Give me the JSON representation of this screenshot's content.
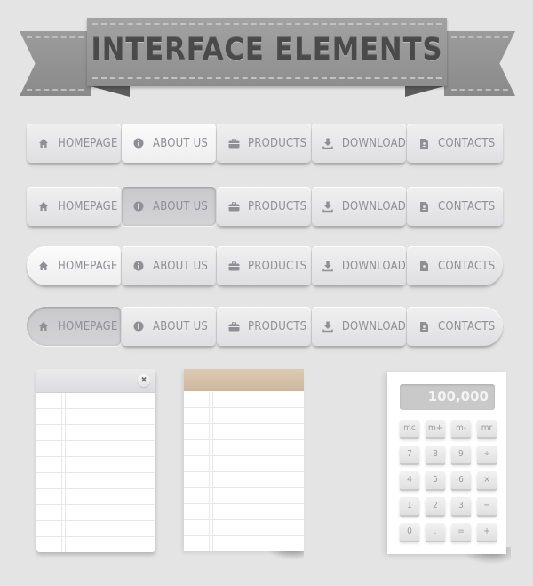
{
  "banner": {
    "title": "INTERFACE ELEMENTS"
  },
  "colors": {
    "background": "#e4e4e4",
    "ribbon": "#969696",
    "button_text": "#8f8f94",
    "note_header": "#d5c0a8"
  },
  "nav_items": [
    {
      "label": "HOMEPAGE",
      "icon": "home-icon"
    },
    {
      "label": "ABOUT US",
      "icon": "info-icon"
    },
    {
      "label": "PRODUCTS",
      "icon": "briefcase-icon"
    },
    {
      "label": "DOWNLOAD",
      "icon": "download-icon"
    },
    {
      "label": "CONTACTS",
      "icon": "contact-card-icon"
    }
  ],
  "nav_bars": [
    {
      "style": "square",
      "state": "hover",
      "highlighted": "ABOUT US"
    },
    {
      "style": "square",
      "state": "pressed",
      "highlighted": "ABOUT US"
    },
    {
      "style": "rounded",
      "state": "hover",
      "highlighted": "HOMEPAGE"
    },
    {
      "style": "rounded",
      "state": "pressed",
      "highlighted": "HOMEPAGE"
    }
  ],
  "notepad_1": {
    "close_glyph": "✖"
  },
  "calculator": {
    "display": "100,000",
    "keys": [
      "mc",
      "m+",
      "m-",
      "mr",
      "7",
      "8",
      "9",
      "÷",
      "4",
      "5",
      "6",
      "×",
      "1",
      "2",
      "3",
      "−",
      "0",
      ".",
      "=",
      "+"
    ]
  }
}
